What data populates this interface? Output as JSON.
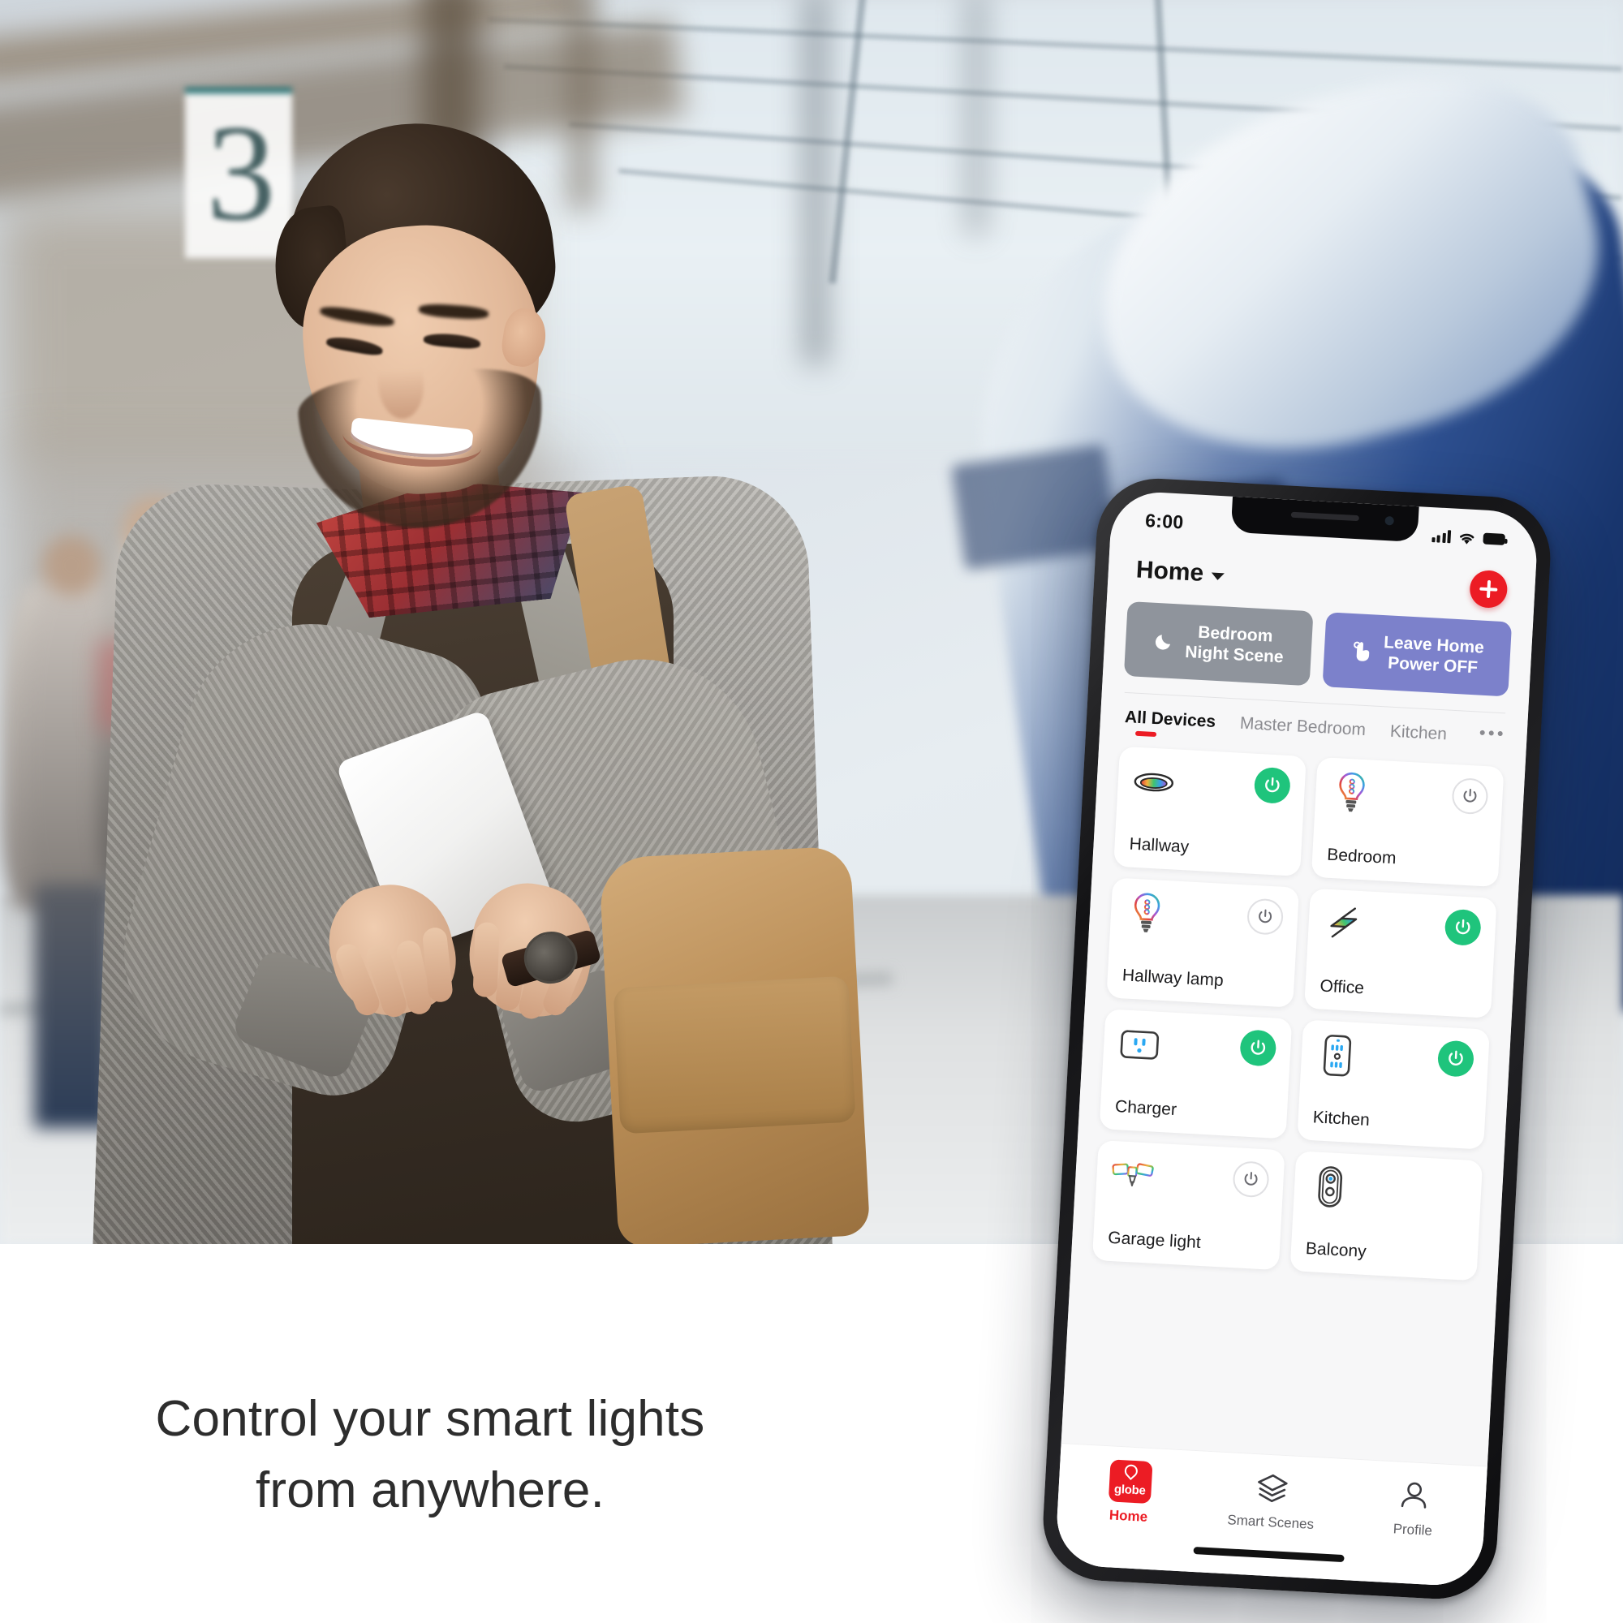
{
  "marketing": {
    "caption_line1": "Control your smart lights",
    "caption_line2": "from anywhere.",
    "platform_sign_number": "3"
  },
  "phone": {
    "status_bar": {
      "time": "6:00",
      "signal_icon": "cellular-signal-icon",
      "wifi_icon": "wifi-icon",
      "battery_icon": "battery-full-icon"
    },
    "header": {
      "title": "Home",
      "chevron_icon": "chevron-down-icon",
      "add_button_icon": "plus-icon"
    },
    "scenes": [
      {
        "label_line1": "Bedroom",
        "label_line2": "Night Scene",
        "icon": "moon-icon",
        "color": "#8f949c"
      },
      {
        "label_line1": "Leave Home",
        "label_line2": "Power OFF",
        "icon": "tap-hand-icon",
        "color": "#7c81cb"
      }
    ],
    "tabs": {
      "items": [
        {
          "label": "All Devices",
          "active": true
        },
        {
          "label": "Master Bedroom",
          "active": false
        },
        {
          "label": "Kitchen",
          "active": false
        }
      ],
      "overflow_icon": "ellipsis-icon",
      "active_indicator_color": "#ec1c24"
    },
    "devices": [
      {
        "name": "Hallway",
        "icon": "flush-mount-ceiling-light-icon",
        "power": "on",
        "power_icon": "power-icon"
      },
      {
        "name": "Bedroom",
        "icon": "rgb-bulb-icon",
        "power": "off",
        "power_icon": "power-icon"
      },
      {
        "name": "Hallway lamp",
        "icon": "rgb-bulb-icon",
        "power": "off",
        "power_icon": "power-icon"
      },
      {
        "name": "Office",
        "icon": "light-strip-icon",
        "power": "on",
        "power_icon": "power-icon"
      },
      {
        "name": "Charger",
        "icon": "smart-plug-outlet-icon",
        "power": "on",
        "power_icon": "power-icon"
      },
      {
        "name": "Kitchen",
        "icon": "wall-outlet-plate-icon",
        "power": "on",
        "power_icon": "power-icon"
      },
      {
        "name": "Garage light",
        "icon": "garage-multi-head-light-icon",
        "power": "off",
        "power_icon": "power-icon"
      },
      {
        "name": "Balcony",
        "icon": "doorbell-camera-icon",
        "power": "none",
        "power_icon": ""
      }
    ],
    "tabbar": [
      {
        "label": "Home",
        "icon": "globe-suite-logo-icon",
        "active": true
      },
      {
        "label": "Smart Scenes",
        "icon": "layers-icon",
        "active": false
      },
      {
        "label": "Profile",
        "icon": "person-icon",
        "active": false
      }
    ],
    "colors": {
      "accent_red": "#ec1c24",
      "power_on_green": "#1fc47c",
      "scene_gray": "#8f949c",
      "scene_purple": "#7c81cb"
    }
  }
}
